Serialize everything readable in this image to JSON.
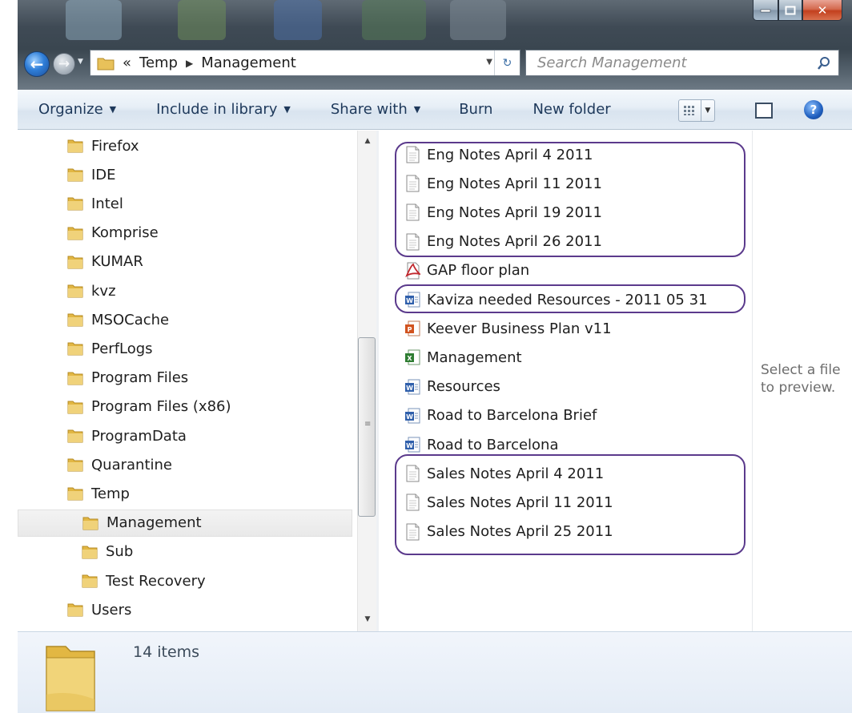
{
  "address": {
    "crumbs": [
      "Temp",
      "Management"
    ],
    "overflow": "«"
  },
  "search": {
    "placeholder": "Search Management"
  },
  "toolbar": {
    "organize": "Organize",
    "include_in_library": "Include in library",
    "share_with": "Share with",
    "burn": "Burn",
    "new_folder": "New folder"
  },
  "nav_tree": [
    {
      "label": "Firefox",
      "level": 0
    },
    {
      "label": "IDE",
      "level": 0
    },
    {
      "label": "Intel",
      "level": 0
    },
    {
      "label": "Komprise",
      "level": 0
    },
    {
      "label": "KUMAR",
      "level": 0
    },
    {
      "label": "kvz",
      "level": 0
    },
    {
      "label": "MSOCache",
      "level": 0
    },
    {
      "label": "PerfLogs",
      "level": 0
    },
    {
      "label": "Program Files",
      "level": 0
    },
    {
      "label": "Program Files (x86)",
      "level": 0
    },
    {
      "label": "ProgramData",
      "level": 0
    },
    {
      "label": "Quarantine",
      "level": 0
    },
    {
      "label": "Temp",
      "level": 0
    },
    {
      "label": "Management",
      "level": 1,
      "selected": true
    },
    {
      "label": "Sub",
      "level": 1
    },
    {
      "label": "Test Recovery",
      "level": 1
    },
    {
      "label": "Users",
      "level": 0
    }
  ],
  "files": [
    {
      "name": "Eng Notes April 4 2011",
      "type": "text"
    },
    {
      "name": "Eng Notes April 11 2011",
      "type": "text"
    },
    {
      "name": "Eng Notes April 19 2011",
      "type": "text"
    },
    {
      "name": "Eng Notes April 26 2011",
      "type": "text"
    },
    {
      "name": "GAP floor plan",
      "type": "pdf"
    },
    {
      "name": "Kaviza needed Resources - 2011 05 31",
      "type": "word"
    },
    {
      "name": "Keever Business Plan v11",
      "type": "powerpoint"
    },
    {
      "name": "Management",
      "type": "excel"
    },
    {
      "name": "Resources",
      "type": "word"
    },
    {
      "name": "Road to Barcelona Brief",
      "type": "word"
    },
    {
      "name": "Road to Barcelona",
      "type": "word"
    },
    {
      "name": "Sales Notes April 4 2011",
      "type": "text"
    },
    {
      "name": "Sales Notes April 11 2011",
      "type": "text"
    },
    {
      "name": "Sales Notes April 25 2011",
      "type": "text"
    }
  ],
  "preview": {
    "message": "Select a file to preview."
  },
  "details": {
    "count": "14 items"
  },
  "colors": {
    "highlight": "#5b3a8c",
    "command_text": "#1e395b",
    "folder": "#e8c15a"
  }
}
